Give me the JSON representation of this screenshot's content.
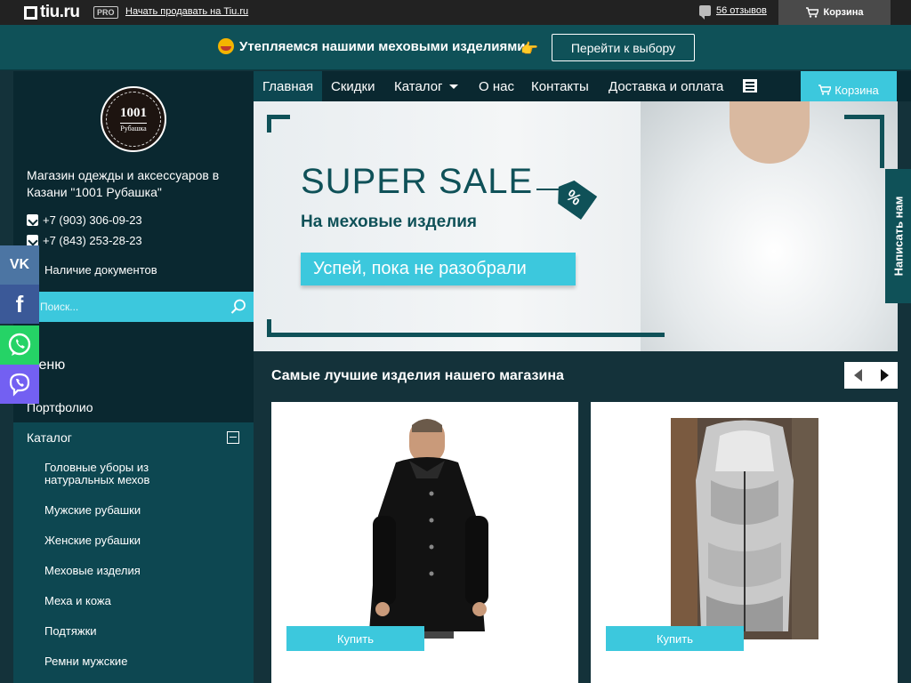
{
  "topbar": {
    "logo_text": "tiu.ru",
    "pro_badge": "PRO",
    "sell_link": "Начать продавать на Tiu.ru",
    "reviews": "56 отзывов",
    "cart": "Корзина"
  },
  "promo": {
    "text": "Утепляемся нашими меховыми изделиями",
    "hand": "👉",
    "button": "Перейти к выбору"
  },
  "sidebar": {
    "logo_number": "1001",
    "logo_word": "Рубашка",
    "description": "Магазин одежды и аксессуаров в Казани \"1001 Рубашка\"",
    "phones": [
      "+7 (903) 306-09-23",
      "+7 (843) 253-28-23"
    ],
    "documents": "Наличие документов",
    "search_placeholder": "Поиск...",
    "menu_title": "Меню",
    "portfolio": "Портфолио",
    "catalog": "Каталог",
    "catalog_items": [
      "Головные уборы из натуральных мехов",
      "Мужские рубашки",
      "Женские рубашки",
      "Меховые изделия",
      "Меха и кожа",
      "Подтяжки",
      "Ремни мужские"
    ]
  },
  "social": {
    "vk": "VK",
    "fb": "f"
  },
  "nav": {
    "items": [
      "Главная",
      "Скидки",
      "Каталог",
      "О нас",
      "Контакты",
      "Доставка и оплата"
    ],
    "cart": "Корзина"
  },
  "banner": {
    "headline": "SUPER SALE",
    "tag": "%",
    "subtitle": "На меховые изделия",
    "button": "Успей, пока не разобрали"
  },
  "write_us": "Написать нам",
  "best": {
    "title": "Самые лучшие изделия нашего магазина",
    "products": [
      {
        "buy": "Купить"
      },
      {
        "buy": "Купить"
      }
    ]
  },
  "colors": {
    "accent": "#3cc8dd",
    "dark_teal": "#0f5158",
    "sidebar": "#0a2830",
    "background": "#14323a"
  }
}
